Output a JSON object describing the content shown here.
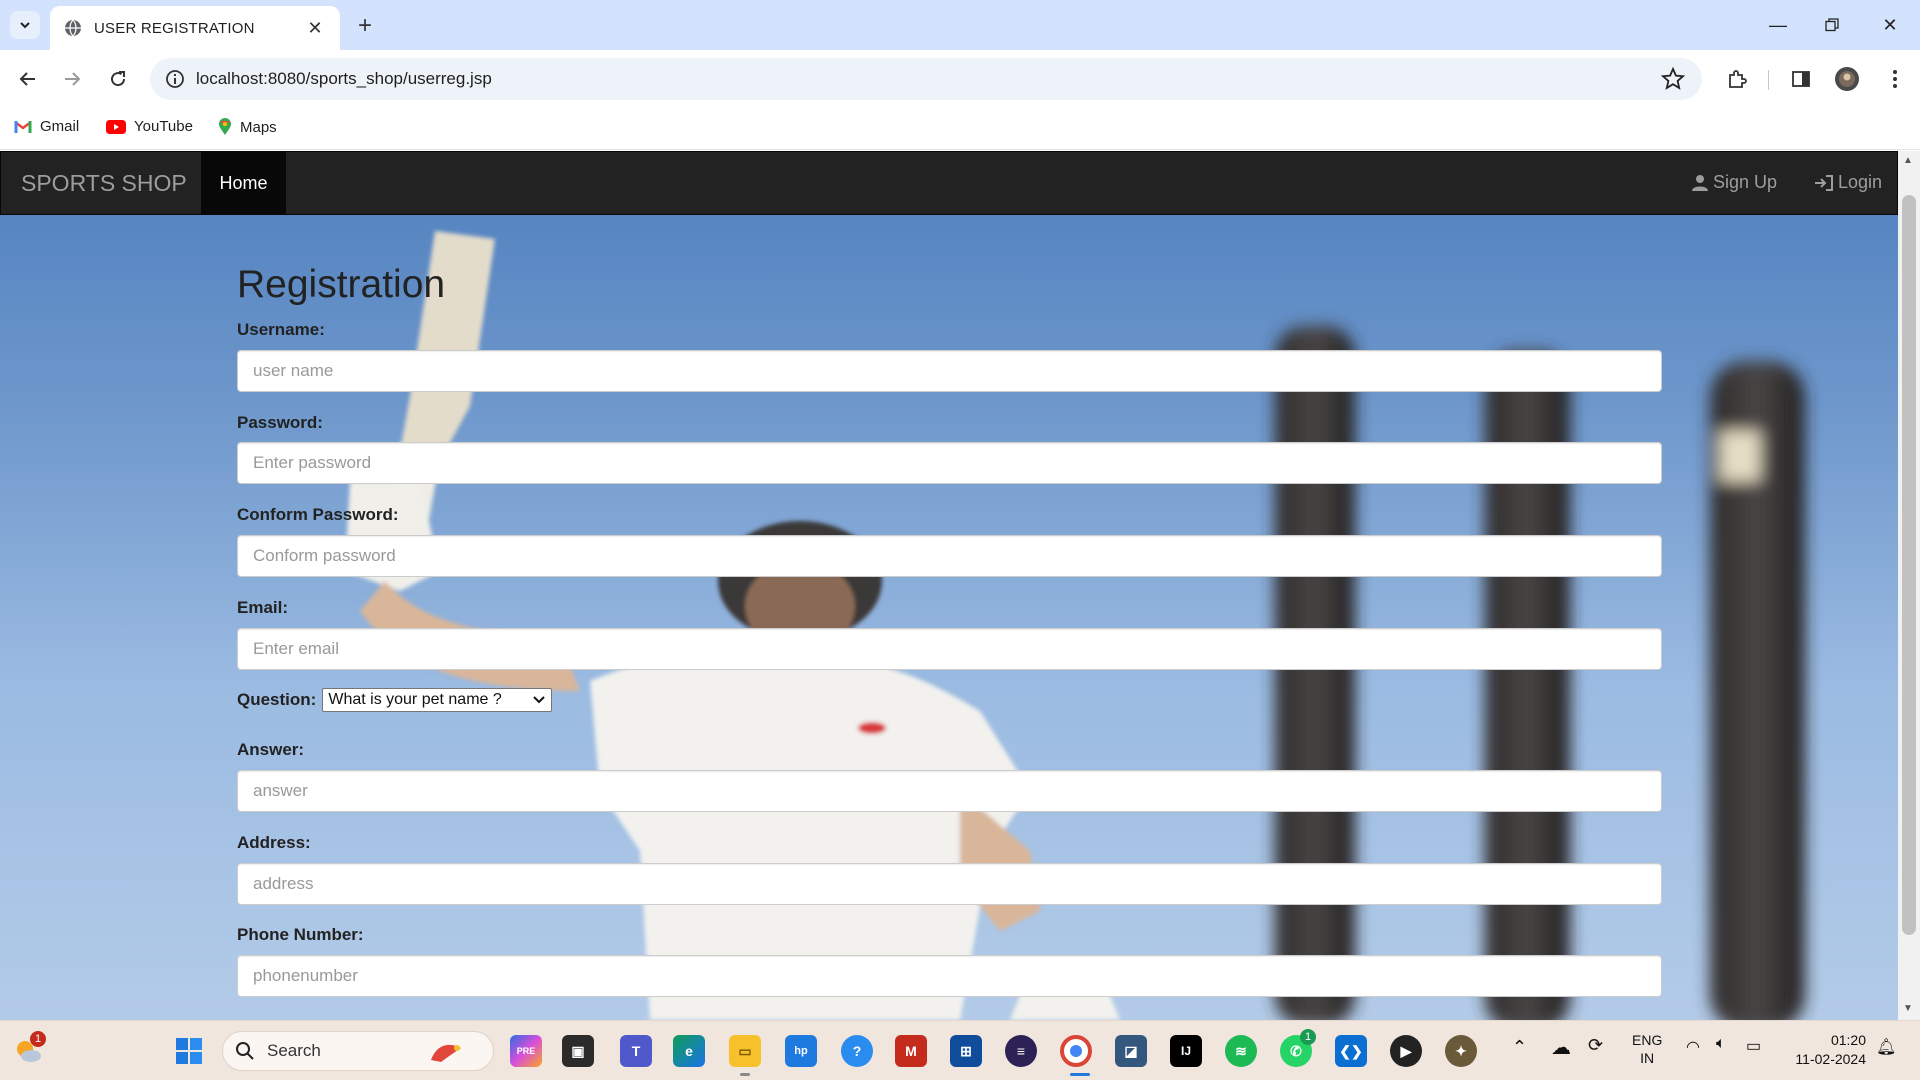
{
  "browser": {
    "tab_title": "USER REGISTRATION",
    "url": "localhost:8080/sports_shop/userreg.jsp",
    "bookmarks": [
      {
        "label": "Gmail",
        "icon": "gmail-icon"
      },
      {
        "label": "YouTube",
        "icon": "youtube-icon"
      },
      {
        "label": "Maps",
        "icon": "maps-icon"
      }
    ]
  },
  "navbar": {
    "brand": "SPORTS SHOP",
    "home": "Home",
    "signup": "Sign Up",
    "login": "Login"
  },
  "form": {
    "heading": "Registration",
    "username_label": "Username:",
    "username_placeholder": "user name",
    "password_label": "Password:",
    "password_placeholder": "Enter password",
    "confirm_label": "Conform Password:",
    "confirm_placeholder": "Conform password",
    "email_label": "Email:",
    "email_placeholder": "Enter email",
    "question_label": "Question:",
    "question_selected": "What is your pet name ?",
    "answer_label": "Answer:",
    "answer_placeholder": "answer",
    "address_label": "Address:",
    "address_placeholder": "address",
    "phone_label": "Phone Number:",
    "phone_placeholder": "phonenumber"
  },
  "taskbar": {
    "search_label": "Search",
    "weather_badge": "1",
    "teams_badge": "1",
    "whatsapp_badge": "1",
    "lang_line1": "ENG",
    "lang_line2": "IN",
    "time": "01:20",
    "date": "11-02-2024"
  },
  "colors": {
    "navbar_bg": "#222222",
    "home_active_bg": "#080808",
    "tabbar_bg": "#d3e3fd",
    "taskbar_bg": "#f0e6de"
  }
}
